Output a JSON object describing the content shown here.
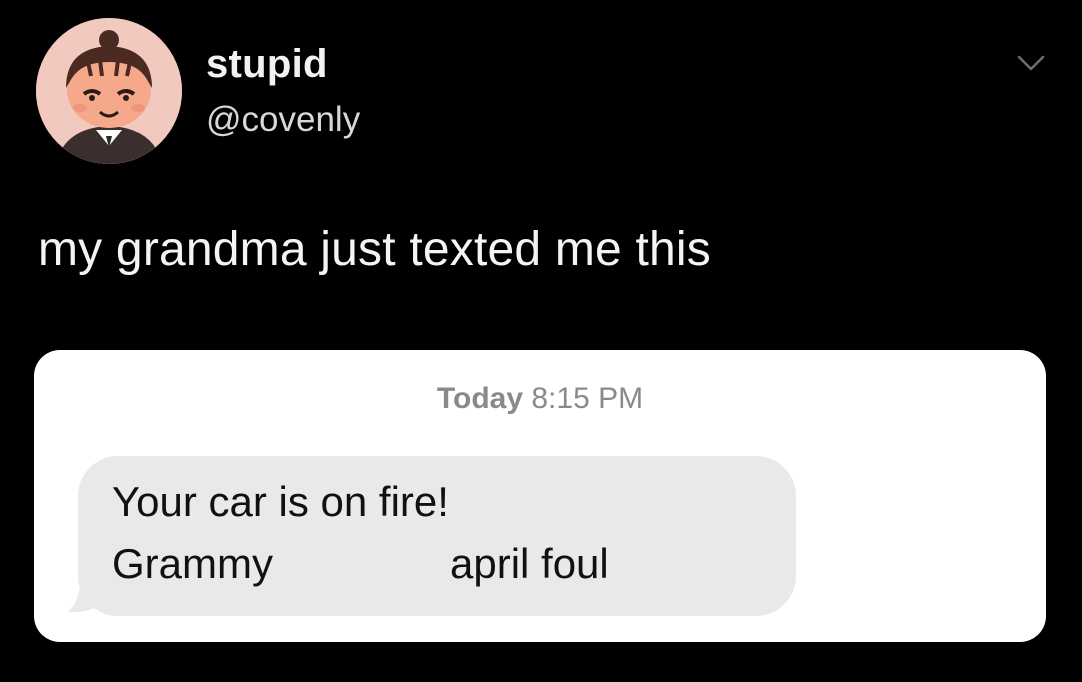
{
  "author": {
    "display_name": "stupid",
    "handle": "@covenly",
    "avatar_icon": "villager-avatar-icon"
  },
  "menu": {
    "icon": "chevron-down-icon"
  },
  "tweet": {
    "text": "my grandma just texted me this"
  },
  "message_screenshot": {
    "timestamp_day": "Today",
    "timestamp_time": "8:15 PM",
    "message_line1": "Your car is on fire!",
    "message_line2_left": "Grammy",
    "message_line2_right": "april foul",
    "bubble_color": "#e9e9eb",
    "card_color": "#ffffff"
  },
  "colors": {
    "background": "#000000",
    "text": "#ffffff",
    "secondary_text": "#8a8a8e"
  }
}
